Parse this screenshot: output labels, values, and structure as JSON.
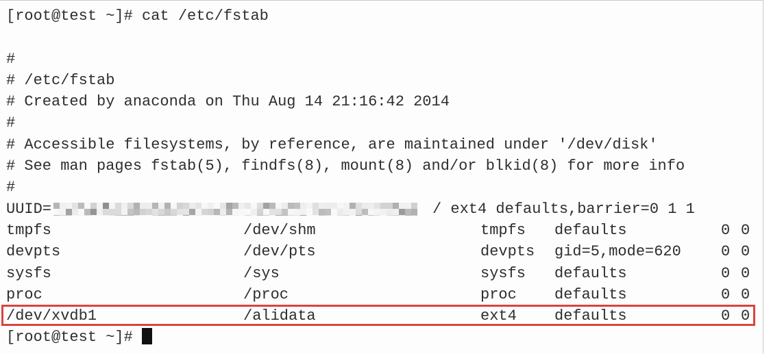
{
  "terminal": {
    "background_color": "#fdfdfd",
    "text_color": "#2e2e2e",
    "highlight_color": "#d9443f",
    "cursor_color": "#111111",
    "prompt": "[root@test ~]# ",
    "command_line": "[root@test ~]# cat /etc/fstab",
    "command": "cat /etc/fstab",
    "final_prompt": "[root@test ~]# ",
    "blank_line": " "
  },
  "fstab": {
    "comments": [
      "#",
      "# /etc/fstab",
      "# Created by anaconda on Thu Aug 14 21:16:42 2014",
      "#",
      "# Accessible filesystems, by reference, are maintained under '/dev/disk'",
      "# See man pages fstab(5), findfs(8), mount(8) and/or blkid(8) for more info",
      "#"
    ],
    "uuid_row": {
      "label": "UUID=",
      "value_redacted": true,
      "mount": "/",
      "type": "ext4",
      "options": "defaults,barrier=0",
      "dump": "1",
      "pass": "1",
      "rest": "/ ext4 defaults,barrier=0 1 1"
    },
    "rows": [
      {
        "device": "tmpfs",
        "mount": "/dev/shm",
        "type": "tmpfs",
        "options": "defaults",
        "dump": "0",
        "pass": "0",
        "highlighted": false
      },
      {
        "device": "devpts",
        "mount": "/dev/pts",
        "type": "devpts",
        "options": "gid=5,mode=620",
        "dump": "0",
        "pass": "0",
        "highlighted": false
      },
      {
        "device": "sysfs",
        "mount": "/sys",
        "type": "sysfs",
        "options": "defaults",
        "dump": "0",
        "pass": "0",
        "highlighted": false
      },
      {
        "device": "proc",
        "mount": "/proc",
        "type": "proc",
        "options": "defaults",
        "dump": "0",
        "pass": "0",
        "highlighted": false
      },
      {
        "device": "/dev/xvdb1",
        "mount": "/alidata",
        "type": "ext4",
        "options": "defaults",
        "dump": "0",
        "pass": "0",
        "highlighted": true
      }
    ]
  },
  "annotation": {
    "highlight_shape": "rectangle",
    "highlight_color": "#d9443f",
    "highlight_target": "/dev/xvdb1 /alidata ext4 defaults 0 0"
  }
}
